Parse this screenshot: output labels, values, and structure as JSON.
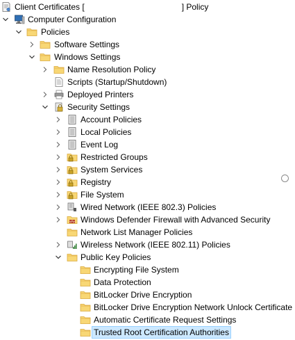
{
  "tree": {
    "root_label_left": "Client Certificates [",
    "root_label_right": "] Policy",
    "computer_configuration": "Computer Configuration",
    "policies": "Policies",
    "software_settings": "Software Settings",
    "windows_settings": "Windows Settings",
    "name_resolution_policy": "Name Resolution Policy",
    "scripts": "Scripts (Startup/Shutdown)",
    "deployed_printers": "Deployed Printers",
    "security_settings": "Security Settings",
    "account_policies": "Account Policies",
    "local_policies": "Local Policies",
    "event_log": "Event Log",
    "restricted_groups": "Restricted Groups",
    "system_services": "System Services",
    "registry": "Registry",
    "file_system": "File System",
    "wired_network": "Wired Network (IEEE 802.3) Policies",
    "firewall": "Windows Defender Firewall with Advanced Security",
    "network_list_manager": "Network List Manager Policies",
    "wireless_network": "Wireless Network (IEEE 802.11) Policies",
    "public_key_policies": "Public Key Policies",
    "encrypting_file_system": "Encrypting File System",
    "data_protection": "Data Protection",
    "bitlocker": "BitLocker Drive Encryption",
    "bitlocker_unlock": "BitLocker Drive Encryption Network Unlock Certificate",
    "auto_cert_request": "Automatic Certificate Request Settings",
    "trusted_root": "Trusted Root Certification Authorities"
  },
  "colors": {
    "selection_bg": "#cce8ff",
    "selection_border": "#99d1ff",
    "folder": "#f8d775",
    "folder_dark": "#e3b24c"
  }
}
